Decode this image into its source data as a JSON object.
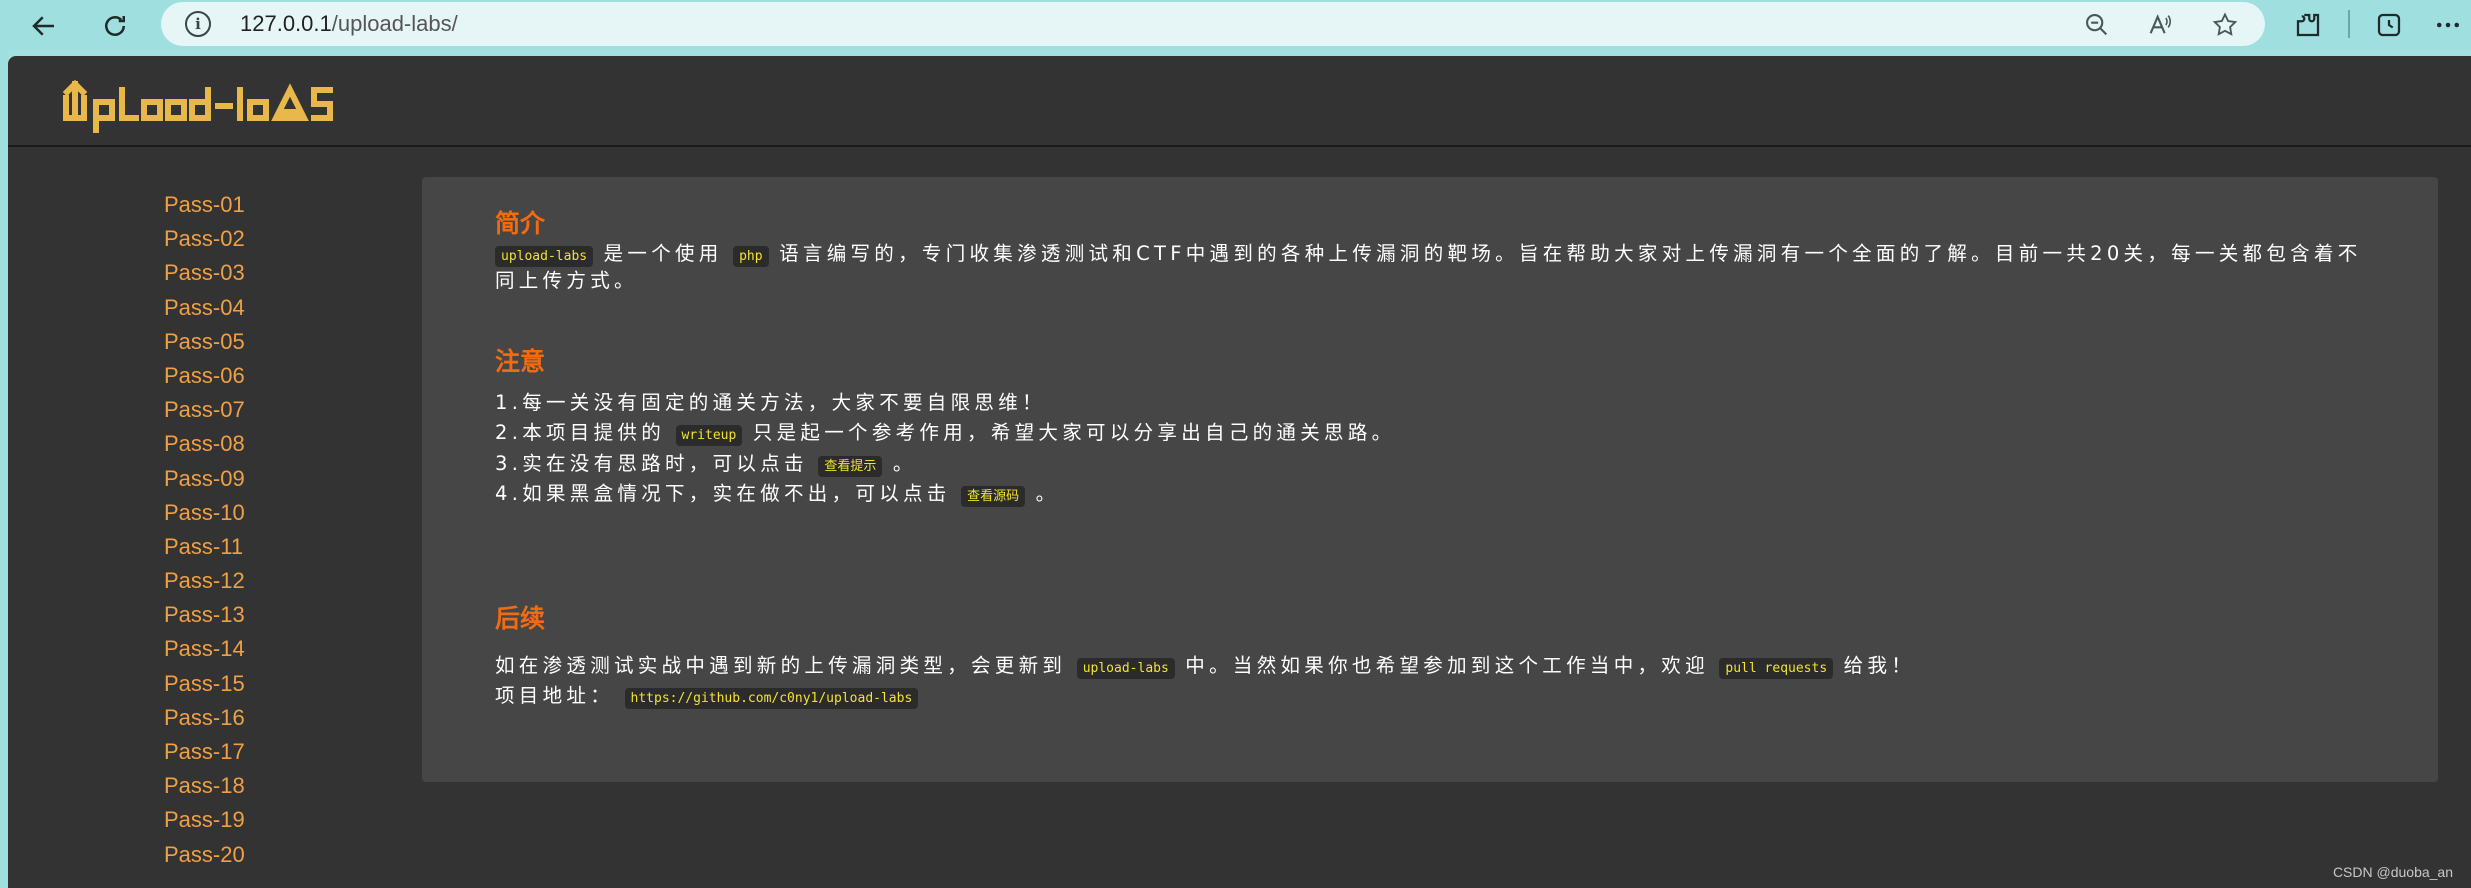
{
  "browser": {
    "url_host": "127.0.0.1",
    "url_path": "/upload-labs/"
  },
  "header": {
    "logo_text": "upload-labs"
  },
  "sidebar": {
    "items": [
      "Pass-01",
      "Pass-02",
      "Pass-03",
      "Pass-04",
      "Pass-05",
      "Pass-06",
      "Pass-07",
      "Pass-08",
      "Pass-09",
      "Pass-10",
      "Pass-11",
      "Pass-12",
      "Pass-13",
      "Pass-14",
      "Pass-15",
      "Pass-16",
      "Pass-17",
      "Pass-18",
      "Pass-19",
      "Pass-20"
    ]
  },
  "intro": {
    "heading": "简介",
    "code1": "upload-labs",
    "t1": "是一个使用",
    "code2": "php",
    "t2": "语言编写的，专门收集渗透测试和CTF中遇到的各种上传漏洞的靶场。旨在帮助大家对上传漏洞有一个全面的了解。目前一共20关，每一关都包含着不同上传方式。"
  },
  "notes": {
    "heading": "注意",
    "n1": "1.每一关没有固定的通关方法，大家不要自限思维！",
    "n2a": "2.本项目提供的",
    "n2code": "writeup",
    "n2b": "只是起一个参考作用，希望大家可以分享出自己的通关思路。",
    "n3a": "3.实在没有思路时，可以点击",
    "n3code": "查看提示",
    "n3b": "。",
    "n4a": "4.如果黑盒情况下，实在做不出，可以点击",
    "n4code": "查看源码",
    "n4b": "。"
  },
  "followup": {
    "heading": "后续",
    "p1a": "如在渗透测试实战中遇到新的上传漏洞类型，会更新到",
    "p1code": "upload-labs",
    "p1b": "中。当然如果你也希望参加到这个工作当中，欢迎",
    "p1code2": "pull requests",
    "p1c": "给我！",
    "p2a": "项目地址：",
    "p2code": "https://github.com/c0ny1/upload-labs"
  },
  "watermark": "CSDN @duoba_an",
  "colors": {
    "accent": "#f26b0f",
    "link": "#f0a044",
    "logo": "#e8b84a",
    "code": "#f2e233"
  }
}
